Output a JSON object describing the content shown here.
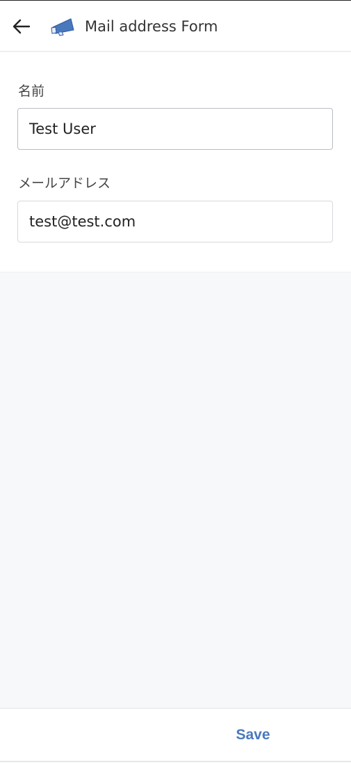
{
  "header": {
    "title": "Mail address Form",
    "back_icon": "arrow-left-icon",
    "app_icon": "megaphone-icon",
    "accent_color": "#4a78bd"
  },
  "form": {
    "name_label": "名前",
    "name_value": "Test User",
    "email_label": "メールアドレス",
    "email_value": "test@test.com"
  },
  "footer": {
    "save_label": "Save"
  }
}
